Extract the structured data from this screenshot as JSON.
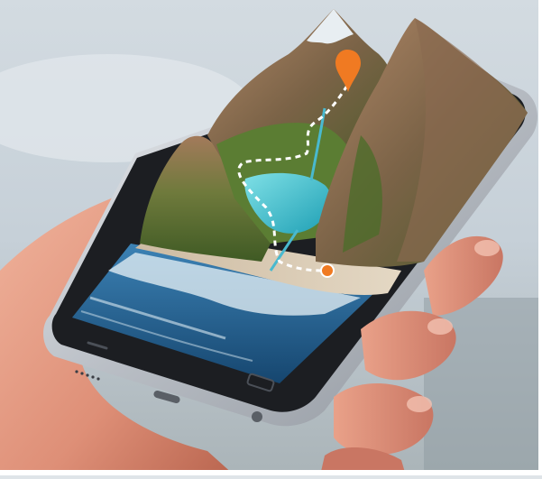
{
  "image": {
    "subject": "hand-holding-smartphone-with-3d-mountain-map",
    "colors": {
      "sky": "#c9d4dc",
      "lake": "#2fb9c9",
      "ocean": "#1f5f95",
      "foam": "#eaf3f7",
      "sand": "#d9c9b0",
      "grass": "#5b7d33",
      "rock": "#8a6a52",
      "phone_body": "#1c1e22",
      "phone_rim": "#c8ccd2",
      "skin": "#e49a82",
      "pin": "#f07a22",
      "trail": "#ffffff"
    }
  }
}
